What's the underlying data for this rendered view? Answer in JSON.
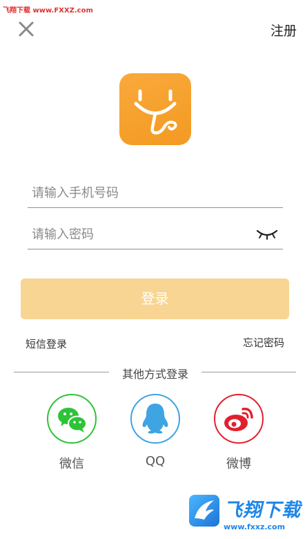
{
  "watermark": {
    "top_text": "飞翔下载 www.FXXZ.com",
    "badge_title": "飞翔下载",
    "badge_url": "www.fxxz.com"
  },
  "header": {
    "close_icon": "close-icon",
    "register_label": "注册"
  },
  "logo": {
    "icon": "stethoscope-smile-logo",
    "color": "#f7a12f"
  },
  "form": {
    "phone_placeholder": "请输入手机号码",
    "phone_value": "",
    "password_placeholder": "请输入密码",
    "password_value": "",
    "password_toggle_icon": "eye-closed-icon"
  },
  "login_button": {
    "label": "登录",
    "color": "#f8d592"
  },
  "links": {
    "sms_login": "短信登录",
    "forgot_password": "忘记密码"
  },
  "other_login": {
    "title": "其他方式登录",
    "methods": [
      {
        "label": "微信",
        "icon": "wechat-icon",
        "color": "#2dc437"
      },
      {
        "label": "QQ",
        "icon": "qq-icon",
        "color": "#3fa4e2"
      },
      {
        "label": "微博",
        "icon": "weibo-icon",
        "color": "#e1202e"
      }
    ]
  }
}
